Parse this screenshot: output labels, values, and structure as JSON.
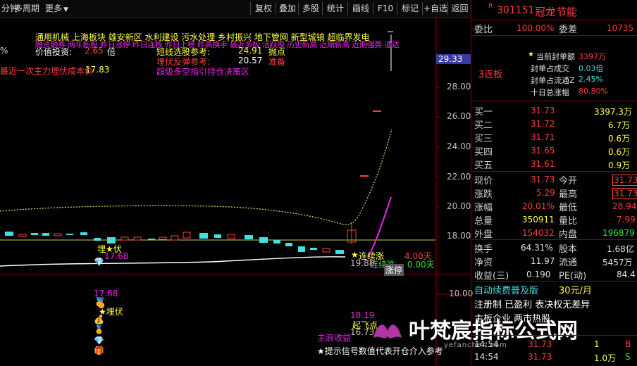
{
  "toolbar": {
    "left": [
      "分钟",
      "多周期",
      "更多"
    ],
    "buttons": [
      "复权",
      "叠加",
      "多股",
      "统计",
      "画线",
      "F10",
      "标记",
      "+自选",
      "返回"
    ]
  },
  "stock": {
    "code": "301151",
    "name": "冠龙节能",
    "r_mark": "R"
  },
  "weibi": {
    "label1": "委比",
    "value1": "100.00%",
    "label2": "委差",
    "value2": "10735"
  },
  "seal": {
    "badge": "3连板",
    "rows": [
      {
        "label": "当前封单额",
        "value": "3397万"
      },
      {
        "label": "封单占成交",
        "value": "0.03倍"
      },
      {
        "label": "封单占流通Z",
        "value": "2.45%"
      },
      {
        "label": "十日总涨幅",
        "value": "80.80%"
      }
    ]
  },
  "bids": [
    {
      "label": "买一",
      "price": "31.73",
      "vol": "3397.3万"
    },
    {
      "label": "买二",
      "price": "31.72",
      "vol": "6.7万"
    },
    {
      "label": "买三",
      "price": "31.71",
      "vol": "0.6万"
    },
    {
      "label": "买四",
      "price": "31.65",
      "vol": "0.6万"
    },
    {
      "label": "买五",
      "price": "31.61",
      "vol": "0.9万"
    }
  ],
  "quote": [
    {
      "l1": "现价",
      "v1": "31.73",
      "l2": "今开",
      "v2": "31.73",
      "c1": "red",
      "c2": "red",
      "box": true
    },
    {
      "l1": "涨跌",
      "v1": "5.29",
      "l2": "最高",
      "v2": "31.73",
      "c1": "red",
      "c2": "red",
      "box": true
    },
    {
      "l1": "涨幅",
      "v1": "20.01%",
      "l2": "最低",
      "v2": "28.94",
      "c1": "red",
      "c2": "red",
      "box": false
    },
    {
      "l1": "总量",
      "v1": "350911",
      "l2": "量比",
      "v2": "7.99",
      "c1": "yellow",
      "c2": "red",
      "box": false
    },
    {
      "l1": "外盘",
      "v1": "154032",
      "l2": "内盘",
      "v2": "196879",
      "c1": "red",
      "c2": "green",
      "box": false
    }
  ],
  "stats": [
    {
      "l1": "换手",
      "v1": "64.31%",
      "l2": "股本",
      "v2": "1.68亿"
    },
    {
      "l1": "净资",
      "v1": "11.97",
      "l2": "流通",
      "v2": "5457万"
    },
    {
      "l1": "收益(三)",
      "v1": "0.190",
      "l2": "PE(动)",
      "v2": "84.4"
    }
  ],
  "promo": {
    "line1a": "自动续费普及版",
    "line1b": "30元/月",
    "line2": "注册制 已盈利 表决权无差异",
    "line3": "主板企业 两市热股"
  },
  "ticks": [
    {
      "time": "14:54",
      "price": "31.73",
      "vol": "1",
      "flag": "B"
    },
    {
      "time": "14:54",
      "price": "31.73",
      "vol": "1.0万",
      "flag": "S"
    }
  ],
  "watermark": {
    "text": "叶梵宸指标公式网",
    "url": "yefanchen.com"
  },
  "price_axis": {
    "labels": [
      "28.00",
      "26.00",
      "24.00",
      "22.00",
      "20.00",
      "18.00"
    ],
    "current": "29.33",
    "lower_label": "10.00"
  },
  "overlay": {
    "tags1": "通用机械  上海板块  雄安新区 水利建设 污水处理 乡村振兴 地下管网 新型城镇 超临界发电",
    "tags2": "融资融券 两年新股 昨日涨停 昨日连板 昨日上榜 昨高换手 最近多板 活跃股 历史新高 近期新高 近期强势 通达",
    "value_label": "价值投资:",
    "value_num": "2.65",
    "value_unit": "倍",
    "cost_label": "最近一次主力埋伏成本价",
    "cost_num": "17.83",
    "short_label": "短线选股参考:",
    "short_num": "24.91",
    "short_tag": "抛点",
    "rebound_label": "埋伏反弹参考:",
    "rebound_num": "20.57",
    "rebound_tag": "准备",
    "super_label": "超级多空指引持仓决策区",
    "pct_prefix": "%",
    "ambush1": "埋★伏",
    "num1": "17.68",
    "cont_label": "连续涨",
    "cont_days": "4.00天",
    "cont_label2": "连续跌",
    "cont_days2": "0.00天",
    "cont_prefix": "19.88",
    "zhangting": "涨停",
    "ambush2": "★埋伏",
    "num2": "17.68",
    "num3": "18.19",
    "qi": "起飞点",
    "num4": "16.73",
    "main_trend": "主浪收益",
    "tip": "★提示信号数值代表开仓介入参考"
  }
}
